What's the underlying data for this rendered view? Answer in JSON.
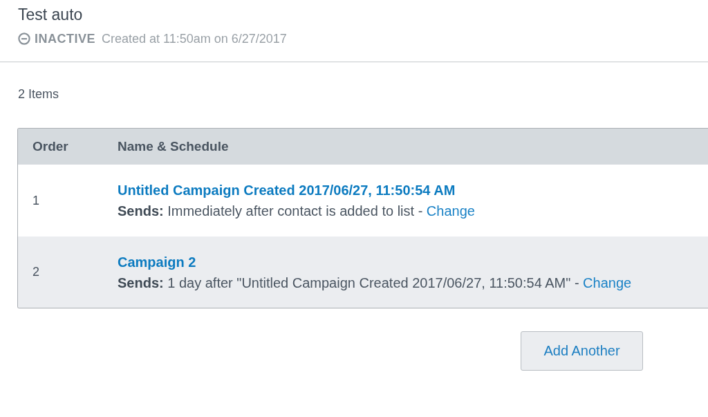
{
  "header": {
    "title": "Test auto",
    "status": {
      "kind": "inactive",
      "label": "INACTIVE"
    },
    "created": "Created at 11:50am on 6/27/2017"
  },
  "list": {
    "count": "2 Items",
    "columns": [
      "Order",
      "Name & Schedule"
    ],
    "rows": [
      {
        "order": "1",
        "name": "Untitled Campaign Created 2017/06/27, 11:50:54 AM",
        "schedule": "**Sends:** Immediately after contact is added to list -",
        "action": "Change"
      },
      {
        "order": "2",
        "name": "Campaign 2",
        "schedule": "**Sends:** 1 day after \"Untitled Campaign Created 2017/06/27, 11:50:54 AM\" -",
        "action": "Change"
      }
    ]
  },
  "add_button": "Add Another"
}
